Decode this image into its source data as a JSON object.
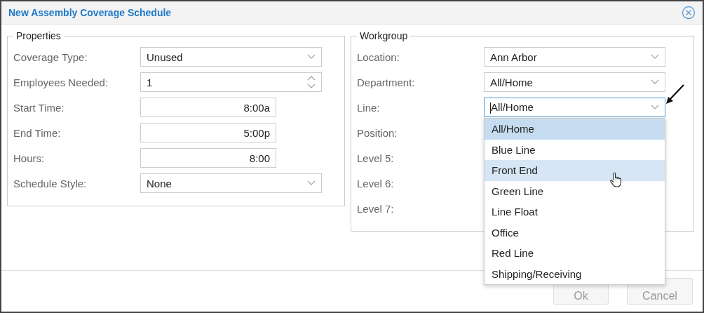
{
  "window": {
    "title": "New Assembly Coverage Schedule"
  },
  "properties": {
    "title": "Properties",
    "rows": [
      {
        "label": "Coverage Type:",
        "kind": "select",
        "value": "Unused"
      },
      {
        "label": "Employees Needed:",
        "kind": "spinner",
        "value": "1"
      },
      {
        "label": "Start Time:",
        "kind": "time",
        "value": "8:00a"
      },
      {
        "label": "End Time:",
        "kind": "time",
        "value": "5:00p"
      },
      {
        "label": "Hours:",
        "kind": "time",
        "value": "8:00"
      },
      {
        "label": "Schedule Style:",
        "kind": "select",
        "value": "None"
      }
    ]
  },
  "workgroup": {
    "title": "Workgroup",
    "rows": [
      {
        "label": "Location:",
        "kind": "select",
        "value": "Ann Arbor",
        "focused": false
      },
      {
        "label": "Department:",
        "kind": "select",
        "value": "All/Home",
        "focused": false
      },
      {
        "label": "Line:",
        "kind": "select",
        "value": "All/Home",
        "focused": true,
        "expanded": true,
        "options": [
          {
            "label": "All/Home",
            "selected": true,
            "hovered": false
          },
          {
            "label": "Blue Line",
            "selected": false,
            "hovered": false
          },
          {
            "label": "Front End",
            "selected": false,
            "hovered": true
          },
          {
            "label": "Green Line",
            "selected": false,
            "hovered": false
          },
          {
            "label": "Line Float",
            "selected": false,
            "hovered": false
          },
          {
            "label": "Office",
            "selected": false,
            "hovered": false
          },
          {
            "label": "Red Line",
            "selected": false,
            "hovered": false
          },
          {
            "label": "Shipping/Receiving",
            "selected": false,
            "hovered": false
          }
        ]
      },
      {
        "label": "Position:",
        "kind": "label"
      },
      {
        "label": "Level 5:",
        "kind": "label"
      },
      {
        "label": "Level 6:",
        "kind": "label"
      },
      {
        "label": "Level 7:",
        "kind": "label"
      }
    ]
  },
  "buttons": [
    "Ok",
    "Cancel"
  ]
}
